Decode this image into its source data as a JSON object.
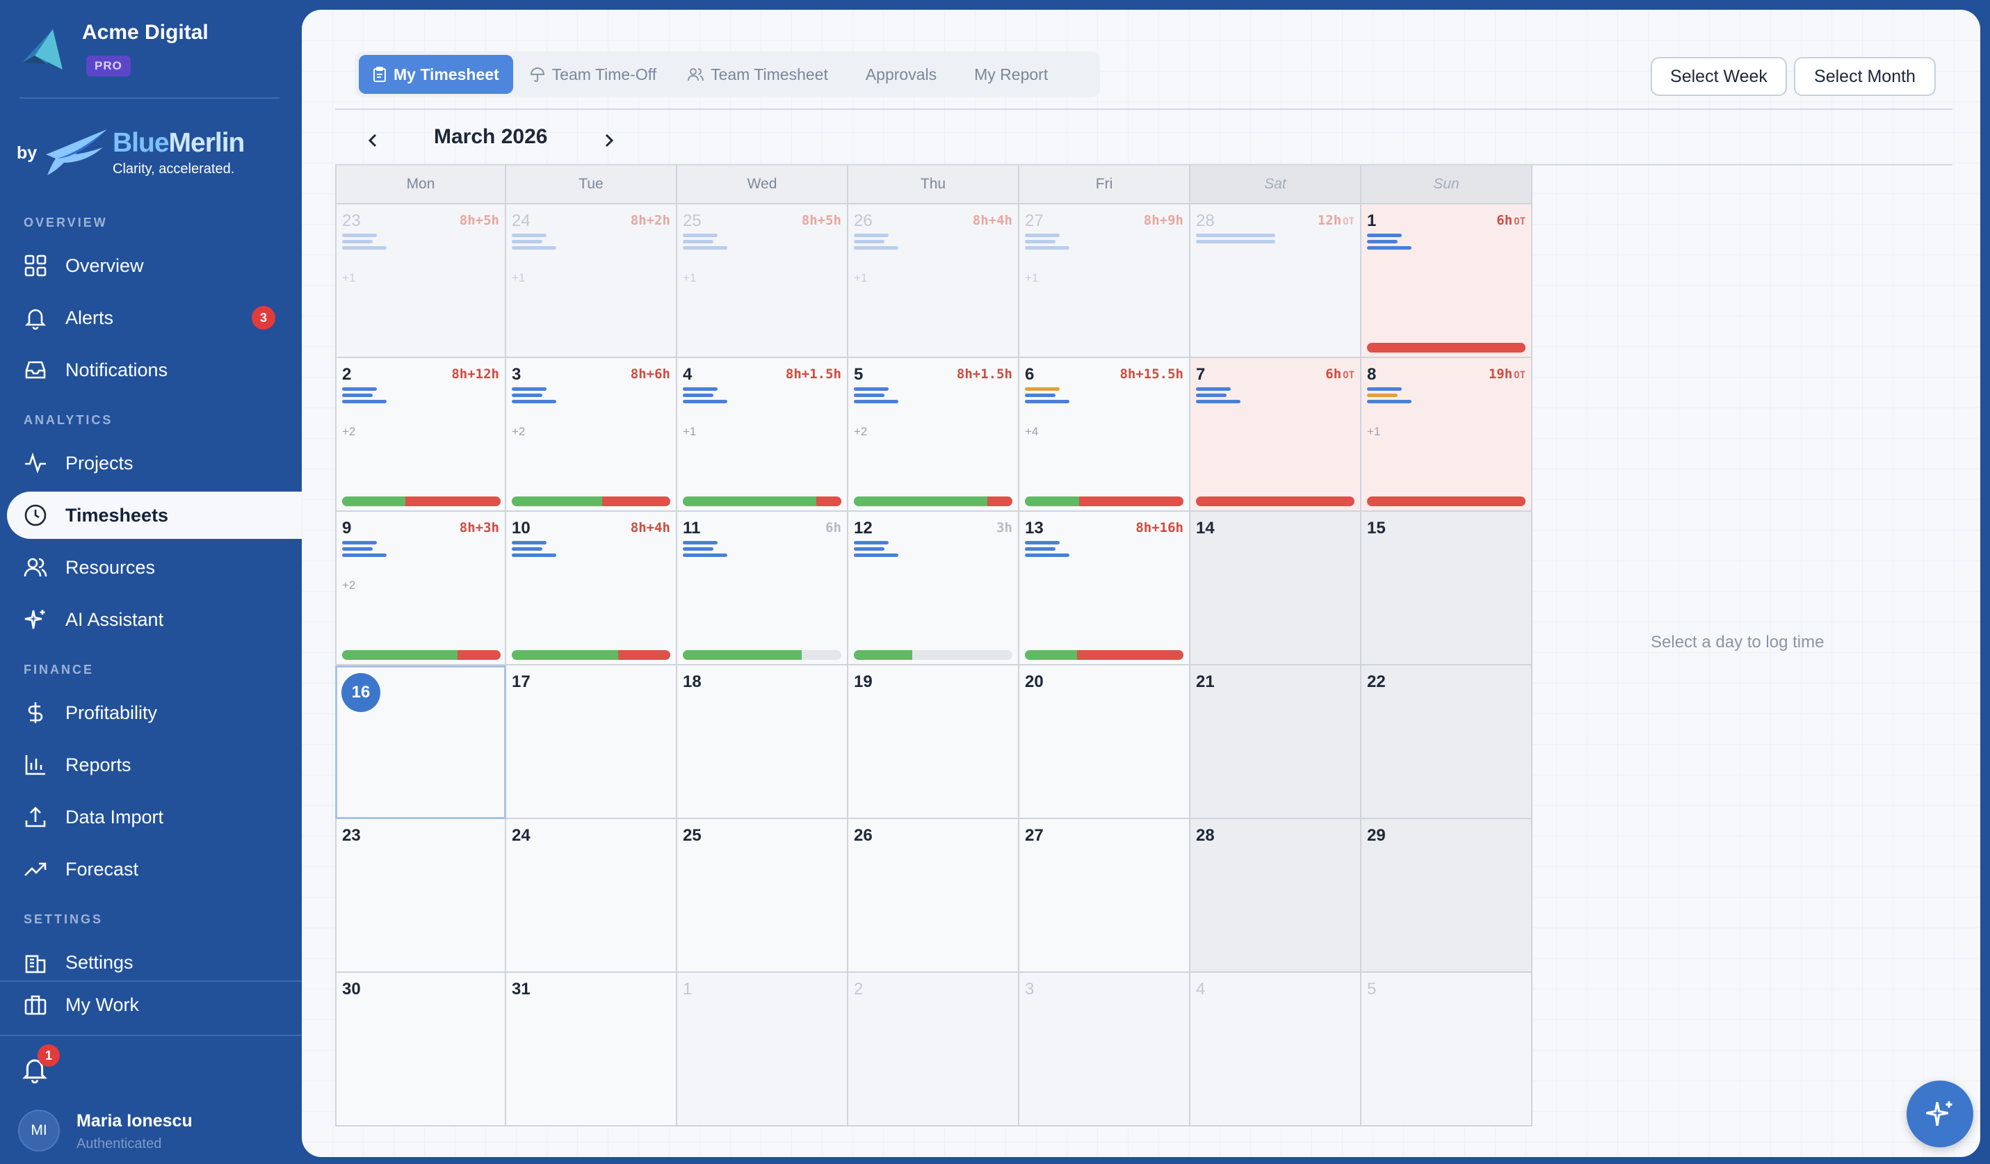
{
  "org": {
    "name": "Acme Digital",
    "plan": "PRO"
  },
  "vendor": {
    "by": "by",
    "name_a": "Blue",
    "name_b": "Merlin",
    "tagline": "Clarity, accelerated."
  },
  "sections": {
    "overview": "OVERVIEW",
    "analytics": "ANALYTICS",
    "finance": "FINANCE",
    "settings": "SETTINGS"
  },
  "nav": {
    "overview": "Overview",
    "alerts": "Alerts",
    "alerts_badge": "3",
    "notifications": "Notifications",
    "projects": "Projects",
    "timesheets": "Timesheets",
    "resources": "Resources",
    "ai_assistant": "AI Assistant",
    "profitability": "Profitability",
    "reports": "Reports",
    "data_import": "Data Import",
    "forecast": "Forecast",
    "settings": "Settings",
    "my_work": "My Work"
  },
  "footer": {
    "bell_badge": "1",
    "avatar_initials": "MI",
    "user_name": "Maria Ionescu",
    "user_status": "Authenticated"
  },
  "tabs": [
    "My Timesheet",
    "Team Time-Off",
    "Team Timesheet",
    "Approvals",
    "My Report"
  ],
  "active_tab": "My Timesheet",
  "buttons": {
    "select_week": "Select Week",
    "select_month": "Select Month"
  },
  "calendar": {
    "month_label": "March 2026",
    "weekdays": [
      "Mon",
      "Tue",
      "Wed",
      "Thu",
      "Fri",
      "Sat",
      "Sun"
    ],
    "ot_label": "OT",
    "weeks": [
      [
        {
          "day": "23",
          "outside": true,
          "hours": "8h+5h",
          "bars": [
            "b",
            "b",
            "b"
          ],
          "more": "+1"
        },
        {
          "day": "24",
          "outside": true,
          "hours": "8h+2h",
          "bars": [
            "b",
            "b",
            "b"
          ],
          "more": "+1"
        },
        {
          "day": "25",
          "outside": true,
          "hours": "8h+5h",
          "bars": [
            "b",
            "b",
            "b"
          ],
          "more": "+1"
        },
        {
          "day": "26",
          "outside": true,
          "hours": "8h+4h",
          "bars": [
            "b",
            "b",
            "b"
          ],
          "more": "+1"
        },
        {
          "day": "27",
          "outside": true,
          "hours": "8h+9h",
          "bars": [
            "b",
            "b",
            "b"
          ],
          "more": "+1"
        },
        {
          "day": "28",
          "outside": true,
          "weekend": true,
          "hours": "12h",
          "ot": true,
          "bars": [
            "b",
            "b"
          ]
        },
        {
          "day": "1",
          "weekend": true,
          "otcell": true,
          "hours": "6h",
          "ot": true,
          "bars": [
            "b",
            "b",
            "b"
          ],
          "progress": [
            0,
            100
          ]
        }
      ],
      [
        {
          "day": "2",
          "hours": "8h+12h",
          "bars": [
            "b",
            "b",
            "b"
          ],
          "more": "+2",
          "progress": [
            40,
            60
          ]
        },
        {
          "day": "3",
          "hours": "8h+6h",
          "bars": [
            "b",
            "b",
            "b"
          ],
          "more": "+2",
          "progress": [
            57,
            43
          ]
        },
        {
          "day": "4",
          "hours": "8h+1.5h",
          "bars": [
            "b",
            "b",
            "b"
          ],
          "more": "+1",
          "progress": [
            84,
            16
          ]
        },
        {
          "day": "5",
          "hours": "8h+1.5h",
          "bars": [
            "b",
            "b",
            "b"
          ],
          "more": "+2",
          "progress": [
            84,
            16
          ]
        },
        {
          "day": "6",
          "hours": "8h+15.5h",
          "bars": [
            "o",
            "b",
            "b"
          ],
          "more": "+4",
          "progress": [
            34,
            66
          ]
        },
        {
          "day": "7",
          "weekend": true,
          "otcell": true,
          "hours": "6h",
          "ot": true,
          "bars": [
            "b",
            "b",
            "b"
          ],
          "progress": [
            0,
            100
          ]
        },
        {
          "day": "8",
          "weekend": true,
          "otcell": true,
          "hours": "19h",
          "ot": true,
          "bars": [
            "b",
            "o",
            "b"
          ],
          "more": "+1",
          "progress": [
            0,
            100
          ]
        }
      ],
      [
        {
          "day": "9",
          "hours": "8h+3h",
          "bars": [
            "b",
            "b",
            "b"
          ],
          "more": "+2",
          "progress": [
            73,
            27
          ]
        },
        {
          "day": "10",
          "hours": "8h+4h",
          "bars": [
            "b",
            "b",
            "b"
          ],
          "progress": [
            67,
            33
          ]
        },
        {
          "day": "11",
          "hours": "6h",
          "grey": true,
          "bars": [
            "b",
            "b",
            "b"
          ],
          "progress": [
            75,
            0
          ]
        },
        {
          "day": "12",
          "hours": "3h",
          "grey": true,
          "bars": [
            "b",
            "b",
            "b"
          ],
          "progress": [
            37,
            0
          ]
        },
        {
          "day": "13",
          "hours": "8h+16h",
          "bars": [
            "b",
            "b",
            "b"
          ],
          "progress": [
            33,
            67
          ]
        },
        {
          "day": "14",
          "weekend": true
        },
        {
          "day": "15",
          "weekend": true
        }
      ],
      [
        {
          "day": "16",
          "today": true
        },
        {
          "day": "17"
        },
        {
          "day": "18"
        },
        {
          "day": "19"
        },
        {
          "day": "20"
        },
        {
          "day": "21",
          "weekend": true
        },
        {
          "day": "22",
          "weekend": true
        }
      ],
      [
        {
          "day": "23"
        },
        {
          "day": "24"
        },
        {
          "day": "25"
        },
        {
          "day": "26"
        },
        {
          "day": "27"
        },
        {
          "day": "28",
          "weekend": true
        },
        {
          "day": "29",
          "weekend": true
        }
      ],
      [
        {
          "day": "30"
        },
        {
          "day": "31"
        },
        {
          "day": "1",
          "outside": true
        },
        {
          "day": "2",
          "outside": true
        },
        {
          "day": "3",
          "outside": true
        },
        {
          "day": "4",
          "outside": true
        },
        {
          "day": "5",
          "outside": true
        }
      ]
    ]
  },
  "hint": "Select a day to log time",
  "colors": {
    "sidebar": "#22519a",
    "accent": "#3d77cc",
    "ot_red": "#df5049",
    "green": "#5fba63",
    "bar_blue": "#4a7fd6",
    "bar_orange": "#e0a13a"
  }
}
